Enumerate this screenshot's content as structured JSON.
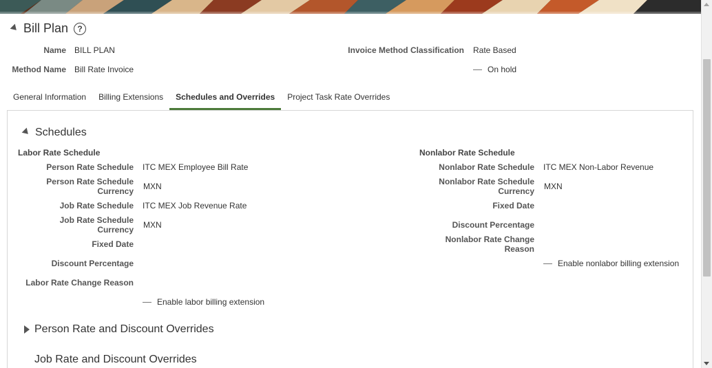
{
  "page": {
    "title": "Bill Plan",
    "header_fields": {
      "name_label": "Name",
      "name_value": "BILL PLAN",
      "method_label": "Method Name",
      "method_value": "Bill Rate Invoice",
      "classification_label": "Invoice Method Classification",
      "classification_value": "Rate Based",
      "on_hold_label": "On hold"
    }
  },
  "tabs": [
    {
      "label": "General Information"
    },
    {
      "label": "Billing Extensions"
    },
    {
      "label": "Schedules and Overrides"
    },
    {
      "label": "Project Task Rate Overrides"
    }
  ],
  "schedules": {
    "title": "Schedules",
    "labor": {
      "heading": "Labor Rate Schedule",
      "person_rate_schedule_label": "Person Rate Schedule",
      "person_rate_schedule_value": "ITC MEX Employee Bill Rate",
      "person_rate_currency_label_1": "Person Rate Schedule",
      "person_rate_currency_label_2": "Currency",
      "person_rate_currency_value": "MXN",
      "job_rate_schedule_label": "Job Rate Schedule",
      "job_rate_schedule_value": "ITC MEX Job Revenue Rate",
      "job_rate_currency_label_1": "Job Rate Schedule",
      "job_rate_currency_label_2": "Currency",
      "job_rate_currency_value": "MXN",
      "fixed_date_label": "Fixed Date",
      "discount_label": "Discount Percentage",
      "change_reason_label": "Labor Rate Change Reason",
      "extension_label": "Enable labor billing extension"
    },
    "nonlabor": {
      "heading": "Nonlabor Rate Schedule",
      "schedule_label": "Nonlabor Rate Schedule",
      "schedule_value": "ITC MEX Non-Labor Revenue",
      "currency_label_1": "Nonlabor Rate Schedule",
      "currency_label_2": "Currency",
      "currency_value": "MXN",
      "fixed_date_label": "Fixed Date",
      "discount_label": "Discount Percentage",
      "change_reason_label_1": "Nonlabor Rate Change",
      "change_reason_label_2": "Reason",
      "extension_label": "Enable nonlabor billing extension"
    }
  },
  "overrides": {
    "person_title": "Person Rate and Discount Overrides",
    "job_title": "Job Rate and Discount Overrides"
  },
  "colors": {
    "active_tab_underline": "#4d7b3b",
    "border": "#d6d6d6"
  }
}
